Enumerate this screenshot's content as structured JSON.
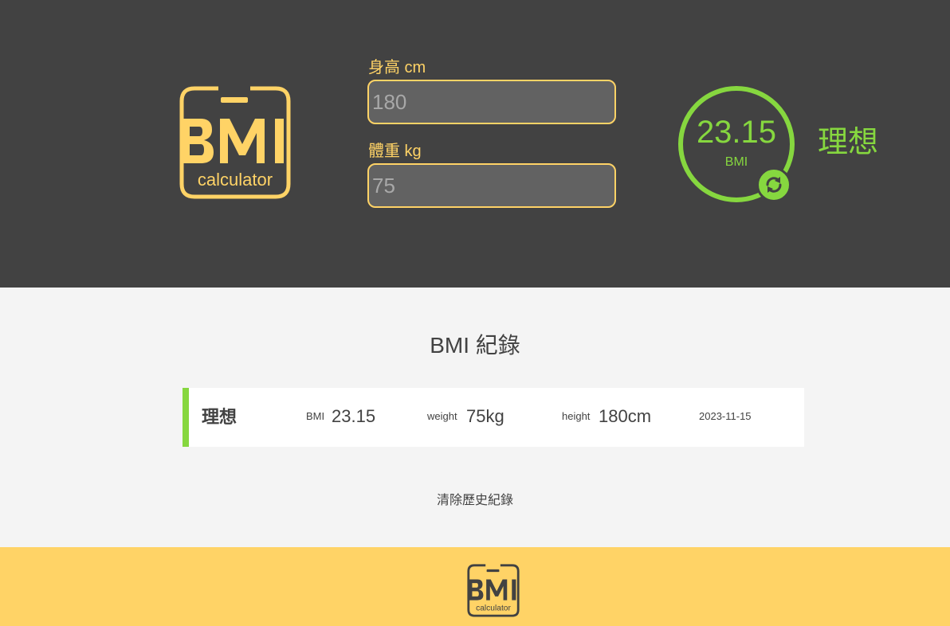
{
  "logo": {
    "icon": "bmi-calculator-logo",
    "text_main": "BMI",
    "text_sub": "calculator"
  },
  "form": {
    "height_label": "身高 cm",
    "height_value": "180",
    "weight_label": "體重 kg",
    "weight_value": "75"
  },
  "result": {
    "value": "23.15",
    "unit": "BMI",
    "status": "理想",
    "reset_icon": "refresh-icon"
  },
  "records": {
    "title": "BMI 紀錄",
    "items": [
      {
        "status": "理想",
        "bmi_label": "BMI",
        "bmi_value": "23.15",
        "weight_label": "weight",
        "weight_value": "75kg",
        "height_label": "height",
        "height_value": "180cm",
        "date": "2023-11-15"
      }
    ],
    "clear_label": "清除歷史紀錄"
  },
  "colors": {
    "header_bg": "#424242",
    "accent_yellow": "#ffd366",
    "ideal_green": "#86d73f",
    "body_bg": "#f4f4f4"
  }
}
